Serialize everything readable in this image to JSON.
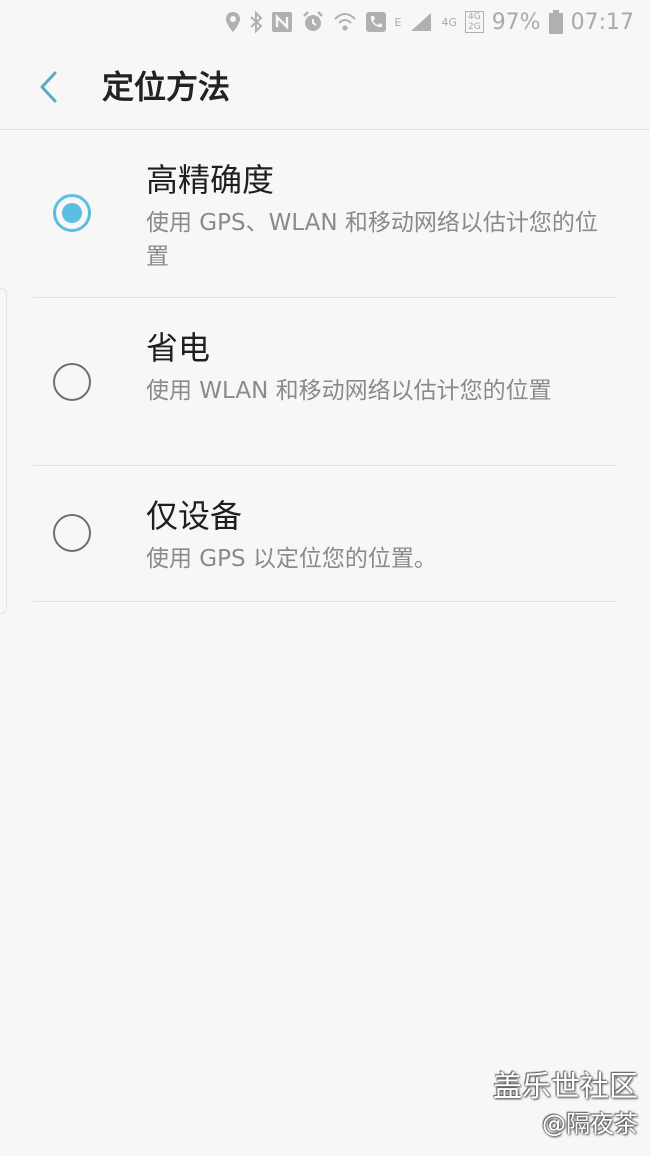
{
  "status_bar": {
    "battery_percent": "97%",
    "time": "07:17",
    "network_e": "E",
    "network_4g": "4G",
    "network_4g_small": "4G",
    "network_2g_small": "2G"
  },
  "header": {
    "title": "定位方法"
  },
  "options": [
    {
      "title": "高精确度",
      "description": "使用 GPS、WLAN 和移动网络以估计您的位置",
      "selected": true
    },
    {
      "title": "省电",
      "description": "使用 WLAN 和移动网络以估计您的位置",
      "selected": false
    },
    {
      "title": "仅设备",
      "description": "使用 GPS 以定位您的位置。",
      "selected": false
    }
  ],
  "watermark": {
    "line1": "盖乐世社区",
    "line2": "@隔夜茶"
  },
  "colors": {
    "accent": "#5bbde0",
    "background": "#f7f7f7"
  }
}
